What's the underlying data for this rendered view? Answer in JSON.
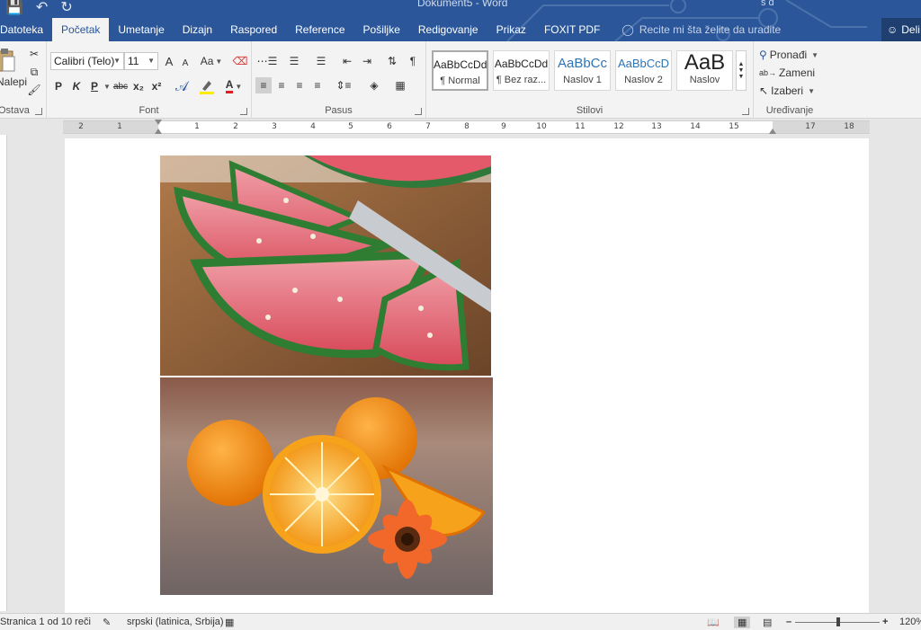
{
  "title_bar": {
    "document_title": "Dokument5 - Word",
    "user": "s d"
  },
  "tabs": [
    {
      "label": "Datoteka"
    },
    {
      "label": "Početak"
    },
    {
      "label": "Umetanje"
    },
    {
      "label": "Dizajn"
    },
    {
      "label": "Raspored"
    },
    {
      "label": "Reference"
    },
    {
      "label": "Pošiljke"
    },
    {
      "label": "Redigovanje"
    },
    {
      "label": "Prikaz"
    },
    {
      "label": "FOXIT PDF"
    }
  ],
  "tell_me": {
    "placeholder": "Recite mi šta želite da uradite"
  },
  "share": {
    "label": "Deli"
  },
  "ribbon": {
    "clipboard": {
      "paste_label": "Nalepi",
      "group_label": "Ostava"
    },
    "font": {
      "font_name": "Calibri (Telo)",
      "font_size": "11",
      "grow": "A",
      "shrink": "A",
      "change_case": "Aa",
      "bold": "P",
      "italic": "K",
      "underline": "P",
      "strikethrough": "abc",
      "subscript": "x₂",
      "superscript": "x²",
      "font_color": "A",
      "group_label": "Font"
    },
    "paragraph": {
      "group_label": "Pasus"
    },
    "styles": {
      "items": [
        {
          "sample": "AaBbCcDd",
          "name": "¶ Normal"
        },
        {
          "sample": "AaBbCcDd",
          "name": "¶ Bez raz..."
        },
        {
          "sample": "AaBbCc",
          "name": "Naslov 1"
        },
        {
          "sample": "AaBbCcD",
          "name": "Naslov 2"
        },
        {
          "sample": "AaB",
          "name": "Naslov"
        }
      ],
      "group_label": "Stilovi"
    },
    "editing": {
      "find": "Pronađi",
      "replace": "Zameni",
      "select": "Izaberi",
      "group_label": "Uređivanje"
    }
  },
  "ruler": {
    "labels": [
      "2",
      "1",
      "1",
      "2",
      "3",
      "4",
      "5",
      "6",
      "7",
      "8",
      "9",
      "10",
      "11",
      "12",
      "13",
      "14",
      "15",
      "17",
      "18"
    ]
  },
  "document": {
    "images": [
      {
        "subject": "watermelon-slices"
      },
      {
        "subject": "oranges-with-gerbera-flower"
      }
    ]
  },
  "status_bar": {
    "page": "Stranica 1 od 1",
    "words": "0 reči",
    "language": "srpski (latinica, Srbija)",
    "zoom_percent": "120%"
  },
  "colors": {
    "accent": "#2b579a",
    "ribbon_bg": "#f3f3f3"
  }
}
